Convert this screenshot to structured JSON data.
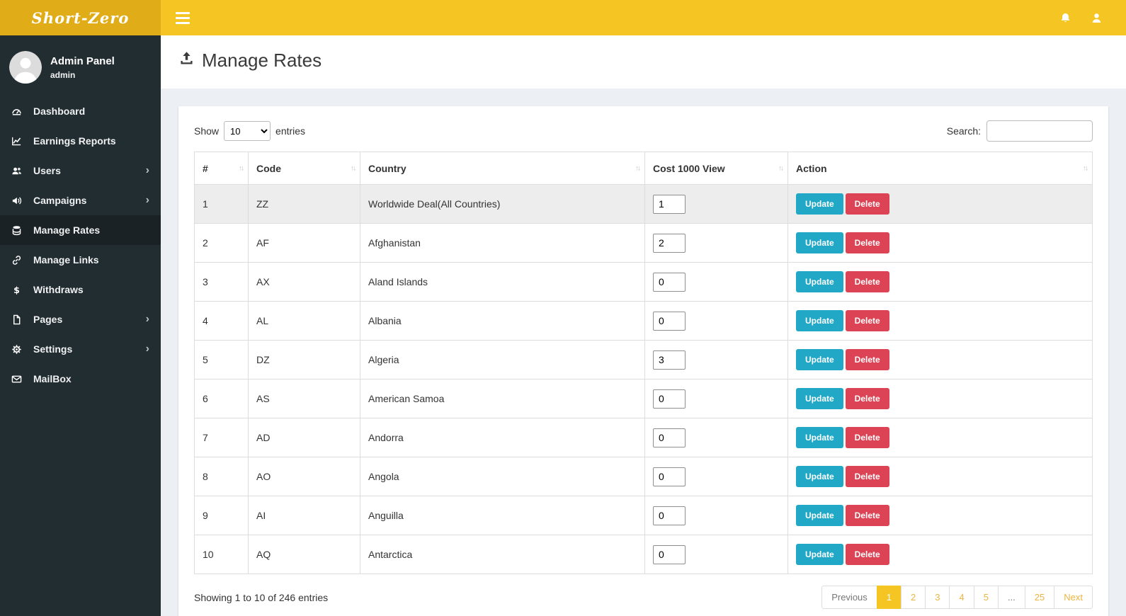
{
  "colors": {
    "topbar": "#f5c524",
    "logo_bg": "#e0ad18",
    "sidebar": "#222d32",
    "sidebar_active": "#1a2226",
    "update_button": "#20a8c6",
    "delete_button": "#dc4456",
    "pagination_active": "#f5c524"
  },
  "icons": {
    "sort": "↑↓",
    "chevron": "›"
  },
  "topbar": {
    "logo": "Short-Zero"
  },
  "sidebar": {
    "profile": {
      "name": "Admin Panel",
      "role": "admin"
    },
    "items": [
      {
        "label": "Dashboard",
        "icon": "gauge-icon",
        "chevron": false,
        "active": false
      },
      {
        "label": "Earnings Reports",
        "icon": "chart-icon",
        "chevron": false,
        "active": false
      },
      {
        "label": "Users",
        "icon": "users-icon",
        "chevron": true,
        "active": false
      },
      {
        "label": "Campaigns",
        "icon": "bullhorn-icon",
        "chevron": true,
        "active": false
      },
      {
        "label": "Manage Rates",
        "icon": "database-icon",
        "chevron": false,
        "active": true
      },
      {
        "label": "Manage Links",
        "icon": "link-icon",
        "chevron": false,
        "active": false
      },
      {
        "label": "Withdraws",
        "icon": "dollar-icon",
        "chevron": false,
        "active": false
      },
      {
        "label": "Pages",
        "icon": "file-icon",
        "chevron": true,
        "active": false
      },
      {
        "label": "Settings",
        "icon": "gear-icon",
        "chevron": true,
        "active": false
      },
      {
        "label": "MailBox",
        "icon": "envelope-icon",
        "chevron": false,
        "active": false
      }
    ]
  },
  "page": {
    "title": "Manage Rates"
  },
  "controls": {
    "show_label": "Show",
    "entries_value": "10",
    "entries_suffix": "entries",
    "search_label": "Search:",
    "search_value": ""
  },
  "table": {
    "columns": [
      "#",
      "Code",
      "Country",
      "Cost 1000 View",
      "Action"
    ],
    "update_label": "Update",
    "delete_label": "Delete",
    "rows": [
      {
        "num": "1",
        "code": "ZZ",
        "country": "Worldwide Deal(All Countries)",
        "cost": "1"
      },
      {
        "num": "2",
        "code": "AF",
        "country": "Afghanistan",
        "cost": "2"
      },
      {
        "num": "3",
        "code": "AX",
        "country": "Aland Islands",
        "cost": "0"
      },
      {
        "num": "4",
        "code": "AL",
        "country": "Albania",
        "cost": "0"
      },
      {
        "num": "5",
        "code": "DZ",
        "country": "Algeria",
        "cost": "3"
      },
      {
        "num": "6",
        "code": "AS",
        "country": "American Samoa",
        "cost": "0"
      },
      {
        "num": "7",
        "code": "AD",
        "country": "Andorra",
        "cost": "0"
      },
      {
        "num": "8",
        "code": "AO",
        "country": "Angola",
        "cost": "0"
      },
      {
        "num": "9",
        "code": "AI",
        "country": "Anguilla",
        "cost": "0"
      },
      {
        "num": "10",
        "code": "AQ",
        "country": "Antarctica",
        "cost": "0"
      }
    ]
  },
  "footer": {
    "info": "Showing 1 to 10 of 246 entries",
    "pagination": [
      {
        "label": "Previous",
        "kind": "muted"
      },
      {
        "label": "1",
        "kind": "active"
      },
      {
        "label": "2",
        "kind": "link"
      },
      {
        "label": "3",
        "kind": "link"
      },
      {
        "label": "4",
        "kind": "link"
      },
      {
        "label": "5",
        "kind": "link"
      },
      {
        "label": "...",
        "kind": "muted"
      },
      {
        "label": "25",
        "kind": "link"
      },
      {
        "label": "Next",
        "kind": "link"
      }
    ]
  }
}
